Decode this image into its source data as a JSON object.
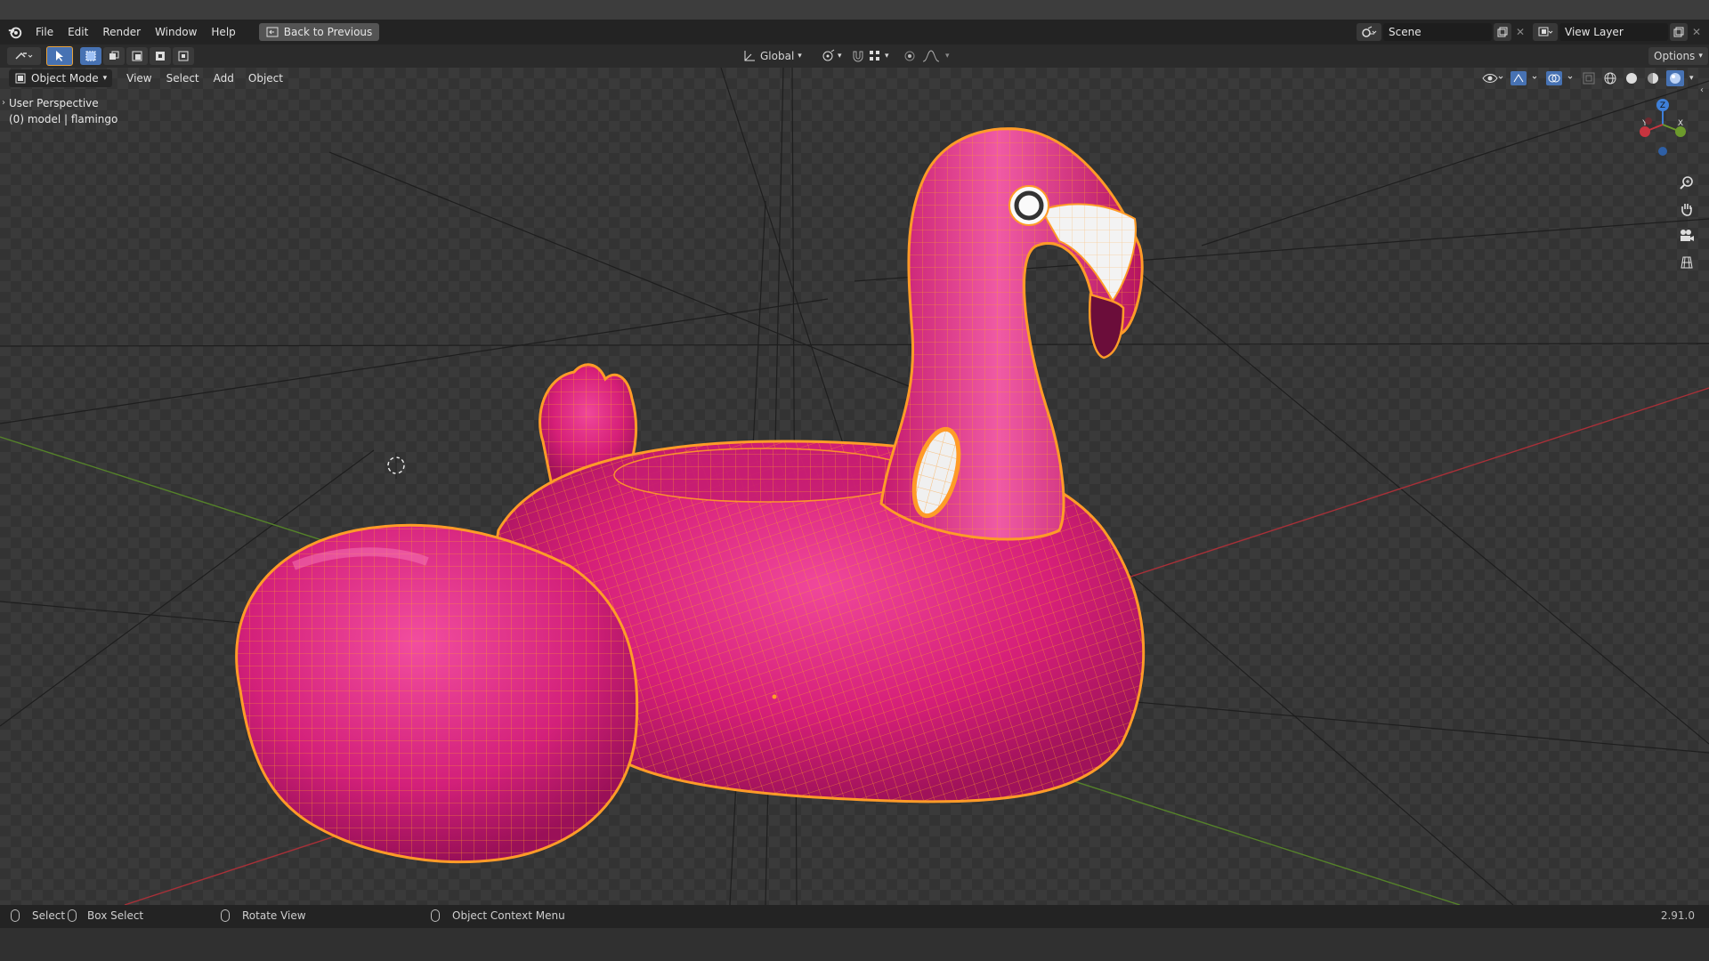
{
  "menubar": {
    "items": [
      "File",
      "Edit",
      "Render",
      "Window",
      "Help"
    ],
    "back_button": "Back to Previous"
  },
  "scene": {
    "name": "Scene"
  },
  "view_layer": {
    "name": "View Layer"
  },
  "toolbar": {
    "transform_orientation": "Global",
    "options_label": "Options"
  },
  "viewport": {
    "mode": "Object Mode",
    "menus": [
      "View",
      "Select",
      "Add",
      "Object"
    ],
    "perspective_label": "User Perspective",
    "object_info": "(0) model | flamingo",
    "gizmo": {
      "x": "X",
      "y": "Y",
      "z": "Z"
    }
  },
  "statusbar": {
    "select": "Select",
    "box_select": "Box Select",
    "rotate_view": "Rotate View",
    "context_menu": "Object Context Menu",
    "version": "2.91.0"
  },
  "colors": {
    "selection_outline": "#ff9b28",
    "flamingo_pink": "#e0247b",
    "x_axis": "#c8343f",
    "y_axis": "#6c9a2c",
    "z_axis": "#3e7fd8",
    "active_button": "#4772b3"
  }
}
